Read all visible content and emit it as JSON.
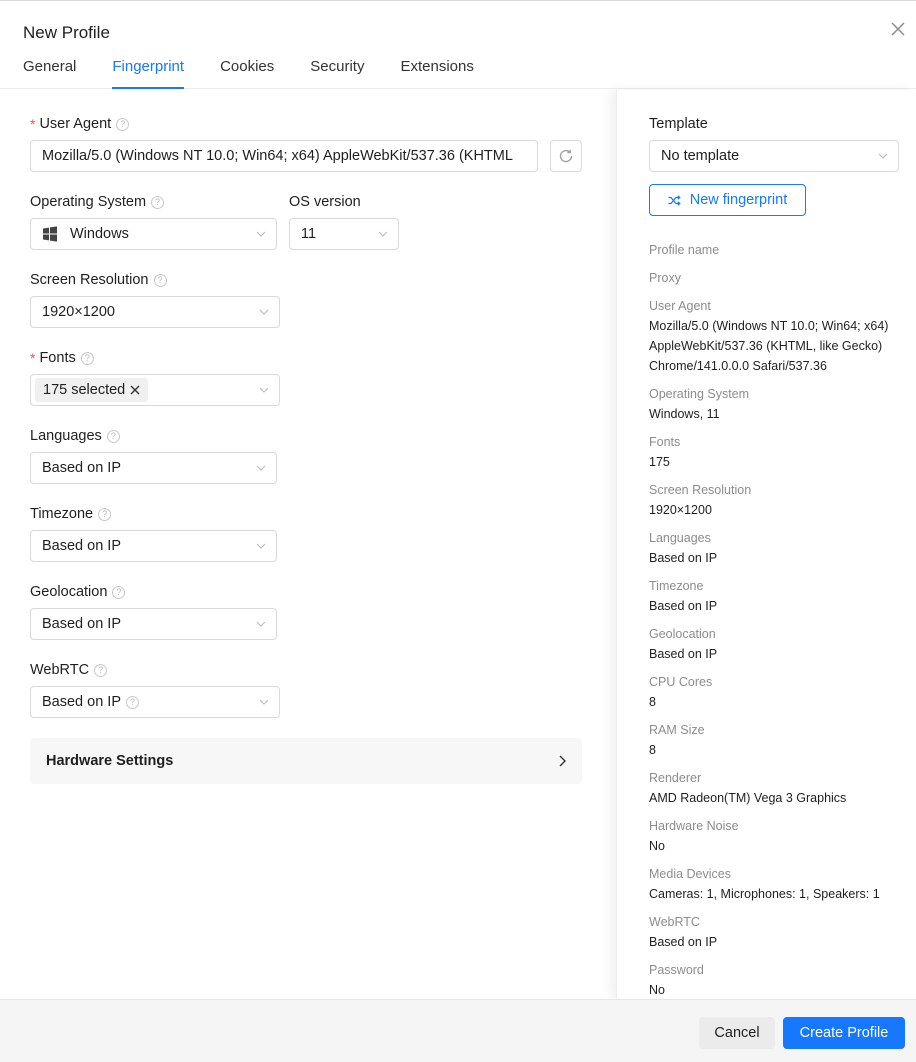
{
  "header": {
    "title": "New Profile",
    "tabs": [
      {
        "label": "General"
      },
      {
        "label": "Fingerprint"
      },
      {
        "label": "Cookies"
      },
      {
        "label": "Security"
      },
      {
        "label": "Extensions"
      }
    ],
    "active_tab": "Fingerprint"
  },
  "form": {
    "user_agent": {
      "label": "User Agent",
      "value": "Mozilla/5.0 (Windows NT 10.0; Win64; x64) AppleWebKit/537.36 (KHTML"
    },
    "os": {
      "label": "Operating System",
      "value": "Windows"
    },
    "os_version": {
      "label": "OS version",
      "value": "11"
    },
    "screen_resolution": {
      "label": "Screen Resolution",
      "value": "1920×1200"
    },
    "fonts": {
      "label": "Fonts",
      "tag": "175 selected"
    },
    "languages": {
      "label": "Languages",
      "value": "Based on IP"
    },
    "timezone": {
      "label": "Timezone",
      "value": "Based on IP"
    },
    "geolocation": {
      "label": "Geolocation",
      "value": "Based on IP"
    },
    "webrtc": {
      "label": "WebRTC",
      "value": "Based on IP"
    },
    "hardware": {
      "label": "Hardware Settings"
    }
  },
  "sidebar": {
    "template_label": "Template",
    "template_value": "No template",
    "new_fingerprint_label": "New fingerprint",
    "summary": [
      {
        "key": "Profile name",
        "value": ""
      },
      {
        "key": "Proxy",
        "value": ""
      },
      {
        "key": "User Agent",
        "value": "Mozilla/5.0 (Windows NT 10.0; Win64; x64) AppleWebKit/537.36 (KHTML, like Gecko) Chrome/141.0.0.0 Safari/537.36"
      },
      {
        "key": "Operating System",
        "value": "Windows, 11"
      },
      {
        "key": "Fonts",
        "value": "175"
      },
      {
        "key": "Screen Resolution",
        "value": "1920×1200"
      },
      {
        "key": "Languages",
        "value": "Based on IP"
      },
      {
        "key": "Timezone",
        "value": "Based on IP"
      },
      {
        "key": "Geolocation",
        "value": "Based on IP"
      },
      {
        "key": "CPU Cores",
        "value": "8"
      },
      {
        "key": "RAM Size",
        "value": "8"
      },
      {
        "key": "Renderer",
        "value": "AMD Radeon(TM) Vega 3 Graphics"
      },
      {
        "key": "Hardware Noise",
        "value": "No"
      },
      {
        "key": "Media Devices",
        "value": "Cameras: 1, Microphones: 1, Speakers: 1"
      },
      {
        "key": "WebRTC",
        "value": "Based on IP"
      },
      {
        "key": "Password",
        "value": "No"
      }
    ]
  },
  "footer": {
    "cancel_label": "Cancel",
    "create_label": "Create Profile"
  },
  "icons": {
    "close": "close-icon",
    "refresh": "refresh-icon",
    "windows": "windows-icon",
    "chevron": "chevron-down-icon",
    "help": "help-circle-icon",
    "shuffle": "shuffle-icon",
    "arrow": "chevron-right-icon"
  },
  "colors": {
    "accent": "#1677ff",
    "required": "#ff4d4f"
  }
}
